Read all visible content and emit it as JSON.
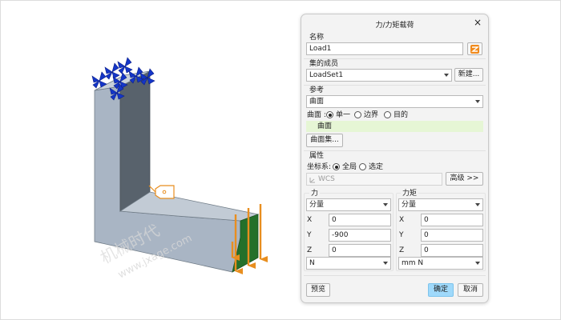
{
  "viewport": {
    "watermark": "机械时代",
    "watermark_url": "www.jxage.com",
    "colors": {
      "front": "#a9b5c4",
      "side": "#58626c",
      "top": "#c2cbd5",
      "selected_face": "#24702a",
      "arrow": "#e88e1f",
      "constraint": "#1436c8"
    }
  },
  "dialog": {
    "title": "力/力矩载荷",
    "close_icon": "×",
    "name": {
      "label": "名称",
      "value": "Load1"
    },
    "member": {
      "label": "集的成员",
      "value": "LoadSet1",
      "new_button": "新建..."
    },
    "reference": {
      "label": "参考",
      "type_value": "曲面",
      "surface_label": "曲面 :",
      "options": [
        {
          "label": "单一",
          "selected": true
        },
        {
          "label": "边界",
          "selected": false
        },
        {
          "label": "目的",
          "selected": false
        }
      ],
      "selected_item": "曲面",
      "surface_set_button": "曲面集..."
    },
    "properties": {
      "label": "属性",
      "csys_label": "坐标系:",
      "csys_options": [
        {
          "label": "全局",
          "selected": true
        },
        {
          "label": "选定",
          "selected": false
        }
      ],
      "csys_value": "WCS",
      "advanced_button": "高级 >>"
    },
    "force": {
      "label": "力",
      "mode": "分量",
      "x_label": "X",
      "x": "0",
      "y_label": "Y",
      "y": "-900",
      "z_label": "Z",
      "z": "0",
      "unit": "N"
    },
    "moment": {
      "label": "力矩",
      "mode": "分量",
      "x_label": "X",
      "x": "0",
      "y_label": "Y",
      "y": "0",
      "z_label": "Z",
      "z": "0",
      "unit": "mm N"
    },
    "buttons": {
      "preview": "预览",
      "ok": "确定",
      "cancel": "取消"
    },
    "colors": {
      "ok_button": "#9fd9fb",
      "selected_row": "#e6f6d5"
    }
  }
}
